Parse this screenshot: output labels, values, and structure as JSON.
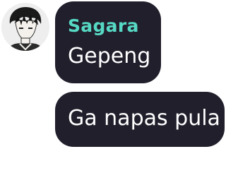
{
  "chat": {
    "avatar_icon": "user-avatar-icon",
    "bubble_color": "#221f2c",
    "sender_color": "#56d9c4",
    "messages": [
      {
        "sender": "Sagara",
        "text": "Gepeng"
      },
      {
        "text": "Ga napas pula"
      }
    ]
  }
}
